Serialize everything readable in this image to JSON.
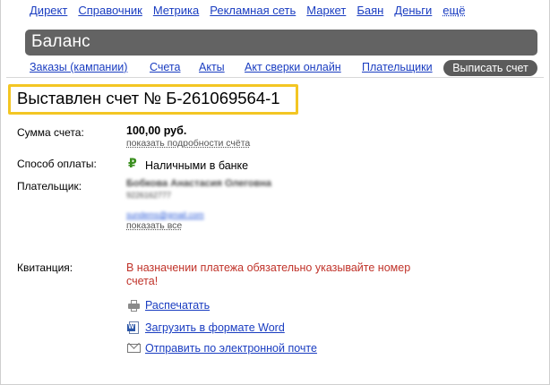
{
  "top_nav": [
    "Директ",
    "Справочник",
    "Метрика",
    "Рекламная сеть",
    "Маркет",
    "Баян",
    "Деньги",
    "ещё"
  ],
  "balance_title": "Баланс",
  "sub_nav": [
    "Заказы (кампании)",
    "Счета",
    "Акты",
    "Акт сверки онлайн",
    "Плательщики"
  ],
  "invoice_button": "Выписать счет",
  "invoice_heading": "Выставлен счет № Б-261069564-1",
  "sum": {
    "label": "Сумма счета:",
    "value": "100,00 руб.",
    "details_link": "показать подробности счёта"
  },
  "payment": {
    "label": "Способ оплаты:",
    "icon": "ruble-icon",
    "value": "Наличными в банке"
  },
  "payer": {
    "label": "Плательщик:",
    "name": "Бобкова Анастасия Олеговна",
    "phone": "9226162777",
    "email": "sundems@gmail.com",
    "show_all_link": "показать все"
  },
  "receipt": {
    "label": "Квитанция:",
    "warning": "В назначении платежа обязательно указывайте номер счета!"
  },
  "actions": {
    "print": "Распечатать",
    "word": "Загрузить в формате Word",
    "email": "Отправить по электронной почте"
  },
  "colors": {
    "accent_link": "#1a3dc1",
    "highlight": "#f3c623",
    "warning": "#c0332a",
    "bar": "#636363"
  }
}
